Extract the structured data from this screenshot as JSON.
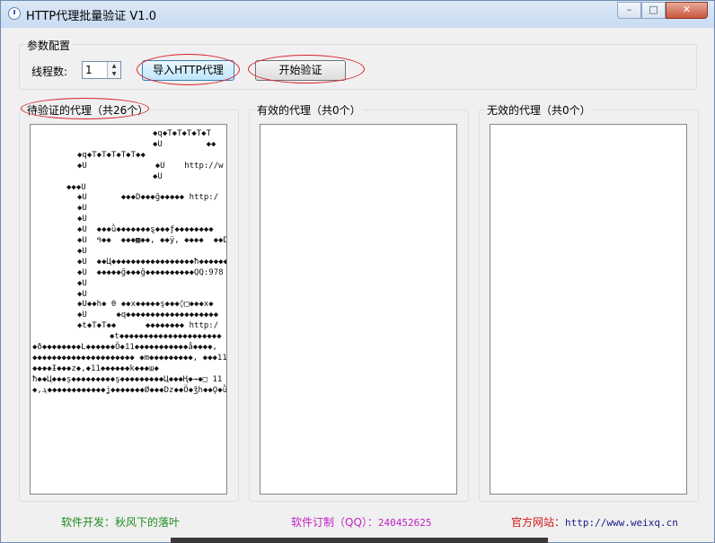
{
  "window": {
    "title": "HTTP代理批量验证 V1.0",
    "controls": {
      "minimize": "–",
      "maximize": "□",
      "close": "✕"
    }
  },
  "settings": {
    "legend": "参数配置",
    "threads_label": "线程数:",
    "threads_value": "1",
    "import_button": "导入HTTP代理",
    "start_button": "开始验证"
  },
  "panels": {
    "pending": {
      "title": "待验证的代理（共26个）",
      "lines": [
        "◆q◆T◆T◆T◆T◆T",
        "◆U         ◆◆",
        "◆q◆T◆T◆T◆T◆T◆◆",
        "◆U              ◆U    http://w",
        "◆U              ◆t◆T◆T◆T◆T◆T",
        "◆◆◆U",
        "◆U       ◆◆◆D◆◆◆ğ◆◆◆◆◆ http:/",
        "◆U",
        "◆U",
        "◆U  ◆◆◆ǜ◆◆◆◆◆◆◆ȿ◆◆◆ƒ◆◆◆◆◆◆◆◆",
        "◆U  ዓ◆◆  ◆◆◆▩◆◆, ◆◆ÿ, ◆◆◆◆  ◆◆D",
        "◆U",
        "◆U  ◆◆Ц◆◆◆◆◆◆◆◆◆◆◆◆◆◆◆◆◆ħ◆◆◆◆◆◆",
        "◆U  ◆◆◆◆◆ğ◆◆◆ğ◆◆◆◆◆◆◆◆◆◆QQ:978",
        "◆U",
        "◆U",
        "◆U◆◆h◆ θ ◆◆x◆◆◆◆◆ş◆◆◆◊□◆◆◆x◆",
        "◆U      ◆q◆◆◆◆◆◆◆◆◆◆◆◆◆◆◆◆◆◆◆",
        "◆t◆T◆T◆◆      ◆◆◆◆◆◆◆◆ http:/",
        "◆t◆◆◆◆◆◆◆◆◆◆◆◆◆◆◆◆◆◆◆◆◆",
        "◆ð◆◆◆◆◆◆◆◆L◆◆◆◆◆◆Ö◆11◆◆◆◆◆◆◆◆◆◆◆å◆◆◆◆,",
        "◆◆◆◆◆◆◆◆◆◆◆◆◆◆◆◆◆◆◆◆◆ ◆m◆◆◆◆◆◆◆◆◆, ◆◆◆11◆",
        "◆◆◆◆Ɨ◆◆◆z◆,◆11◆◆◆◆◆◆k◆◆◆ш◆",
        "ħ◆◆Ц◆◆◆ş◆◆◆◆◆◆◆◆◆ş◆◆◆◆◆◆◆◆◆Ц◆◆◆Ң◆→◆□ 11",
        "◆,ܔ◆◆◆◆◆◆◆◆◆◆◆◆ʝ◆◆◆◆◆◆◆Ø◆◆◆Dz◆◆Ö◆ǯh◆◆Ǫ◆ǜ"
      ]
    },
    "valid": {
      "title": "有效的代理（共0个）"
    },
    "invalid": {
      "title": "无效的代理（共0个）"
    }
  },
  "footer": {
    "developer": "软件开发：秋风下的落叶",
    "custom_label": "软件订制（QQ）：",
    "custom_qq": "240452625",
    "site_label": "官方网站：",
    "site_url": "http://www.weixq.cn"
  },
  "colors": {
    "developer": "#1e8c1e",
    "custom": "#c21fc2",
    "site_label": "#d41818",
    "site_url": "#1a1a8c",
    "annotation": "#d8222a"
  }
}
